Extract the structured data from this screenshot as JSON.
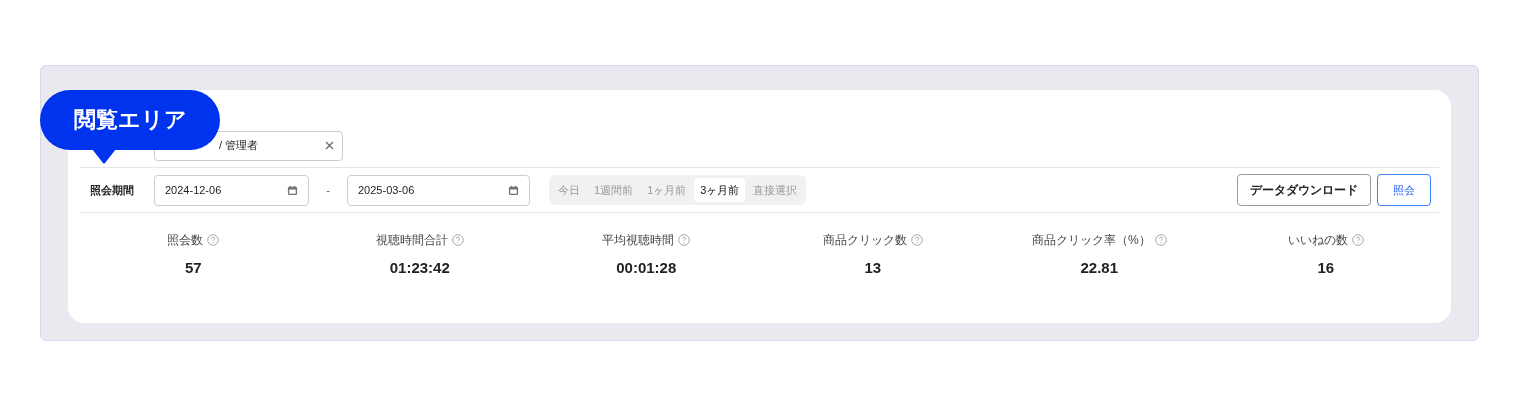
{
  "callout": {
    "label": "閲覧エリア"
  },
  "account_field": {
    "value": "/ 管理者"
  },
  "period": {
    "label": "照会期間",
    "start": "2024-12-06",
    "separator": "-",
    "end": "2025-03-06"
  },
  "presets": [
    {
      "label": "今日",
      "selected": false
    },
    {
      "label": "1週間前",
      "selected": false
    },
    {
      "label": "1ヶ月前",
      "selected": false
    },
    {
      "label": "3ヶ月前",
      "selected": true
    },
    {
      "label": "直接選択",
      "selected": false
    }
  ],
  "buttons": [
    {
      "label": "データダウンロード",
      "kind": "secondary"
    },
    {
      "label": "照会",
      "kind": "primary"
    }
  ],
  "stats": [
    {
      "label": "照会数",
      "value": "57"
    },
    {
      "label": "視聴時間合計",
      "value": "01:23:42"
    },
    {
      "label": "平均視聴時間",
      "value": "00:01:28"
    },
    {
      "label": "商品クリック数",
      "value": "13"
    },
    {
      "label": "商品クリック率（%）",
      "value": "22.81"
    },
    {
      "label": "いいねの数",
      "value": "16"
    }
  ]
}
